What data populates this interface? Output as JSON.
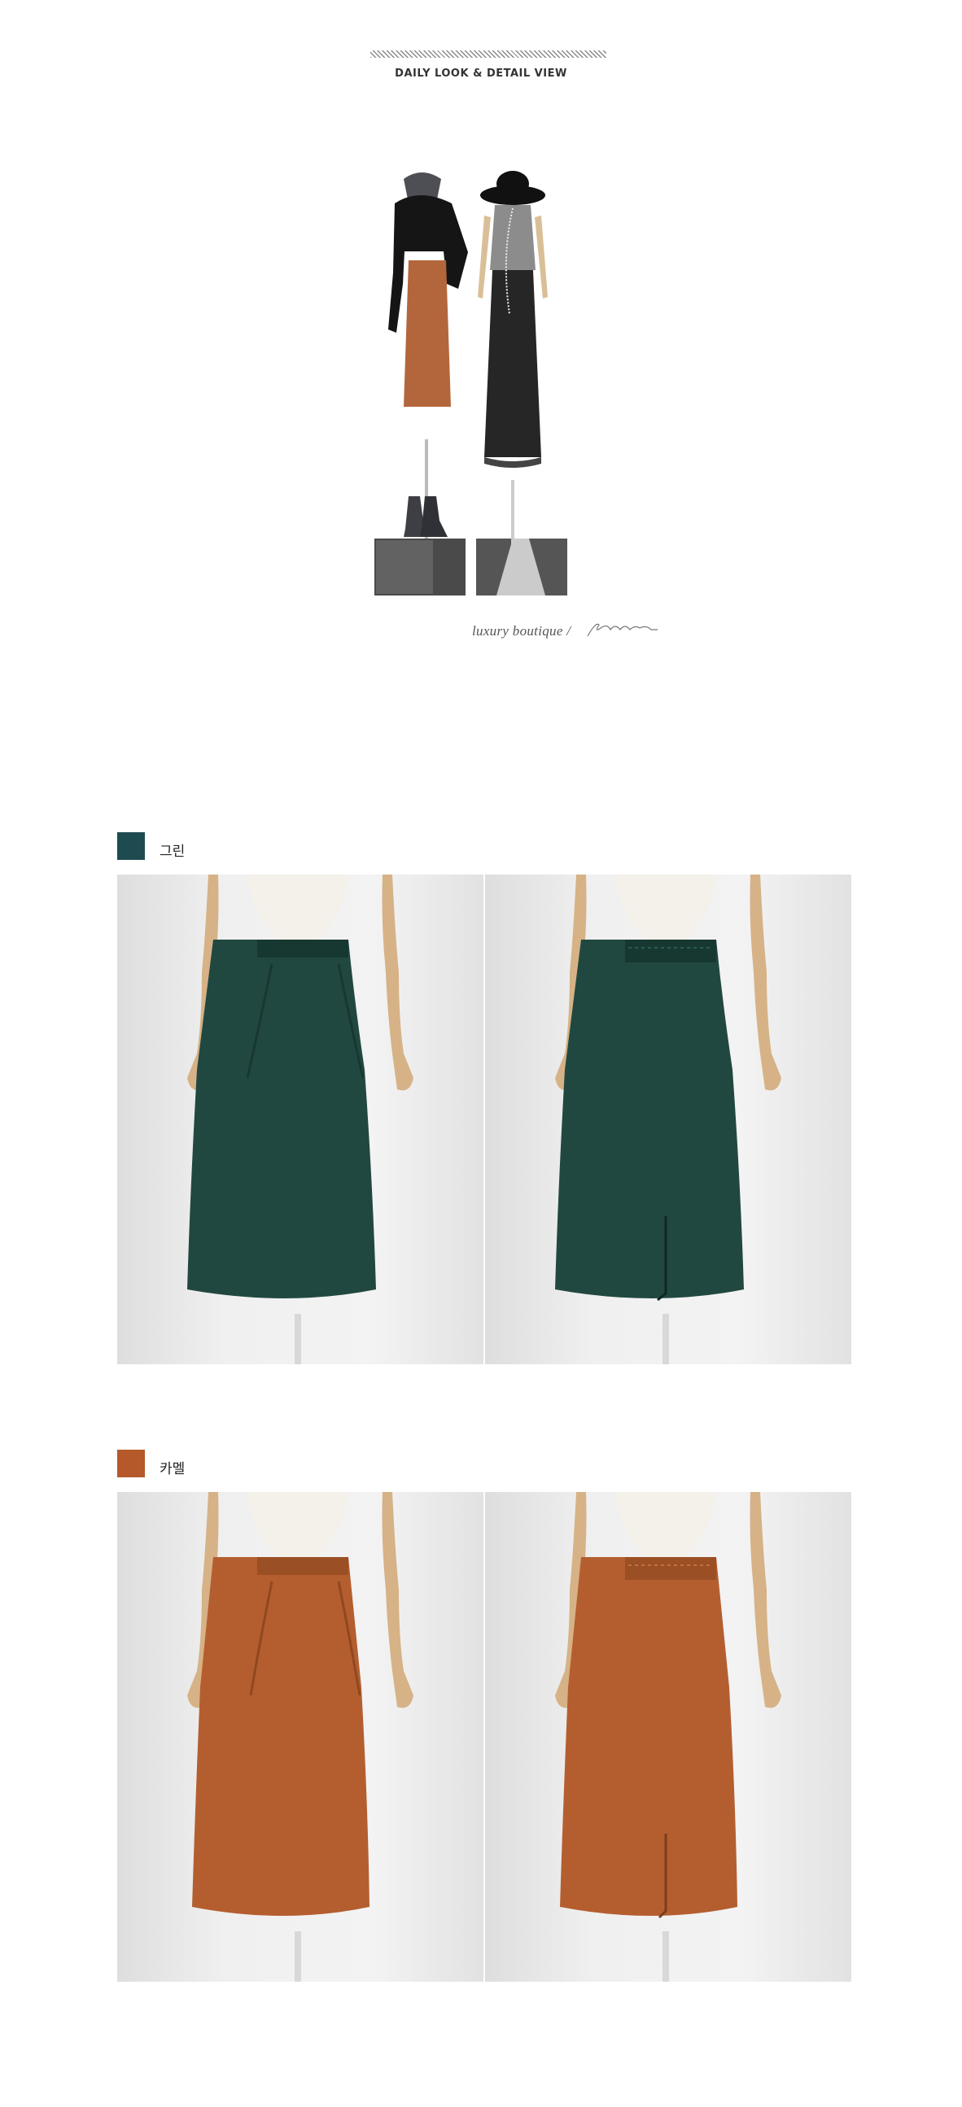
{
  "header": {
    "title": "DAILY LOOK & DETAIL VIEW"
  },
  "daily_look": {
    "tagline": "luxury boutique /",
    "signature": "Jblanc"
  },
  "colors": [
    {
      "name": "그린",
      "swatch": "#1e4b4f",
      "skirt": "#214840",
      "skirt_dark": "#173831"
    },
    {
      "name": "카멜",
      "swatch": "#b5582a",
      "skirt": "#b45e2f",
      "skirt_dark": "#8f4820"
    }
  ]
}
